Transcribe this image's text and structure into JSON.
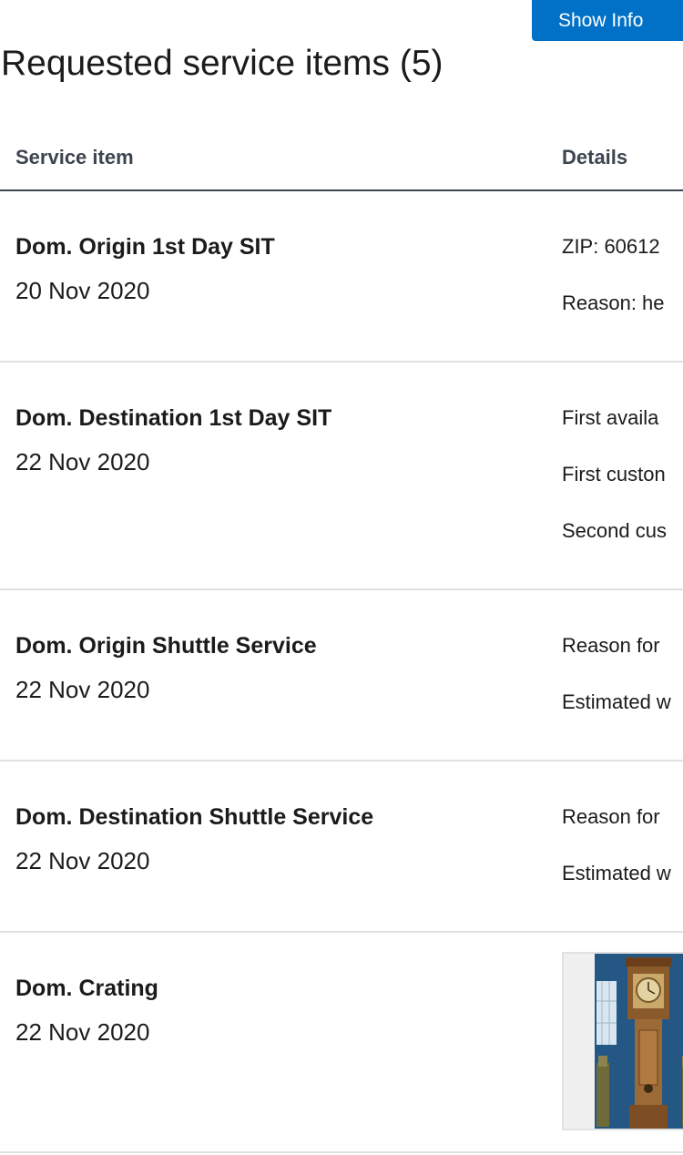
{
  "header": {
    "show_info_label": "Show Info",
    "title": "Requested service items (5)"
  },
  "table": {
    "columns": [
      "Service item",
      "Details"
    ],
    "rows": [
      {
        "name": "Dom. Origin 1st Day SIT",
        "date": "20 Nov 2020",
        "details": [
          "ZIP: 60612",
          "Reason: he"
        ]
      },
      {
        "name": "Dom. Destination 1st Day SIT",
        "date": "22 Nov 2020",
        "details": [
          "First availa",
          "First custon",
          "Second cus"
        ]
      },
      {
        "name": "Dom. Origin Shuttle Service",
        "date": "22 Nov 2020",
        "details": [
          "Reason for",
          "Estimated w"
        ]
      },
      {
        "name": "Dom. Destination Shuttle Service",
        "date": "22 Nov 2020",
        "details": [
          "Reason for",
          "Estimated w"
        ]
      },
      {
        "name": "Dom. Crating",
        "date": "22 Nov 2020",
        "details": [],
        "image": "grandfather-clock-photo"
      }
    ]
  },
  "colors": {
    "primary_button": "#0071c6",
    "header_rule": "#3d4551",
    "row_rule": "#dfe1e2"
  }
}
